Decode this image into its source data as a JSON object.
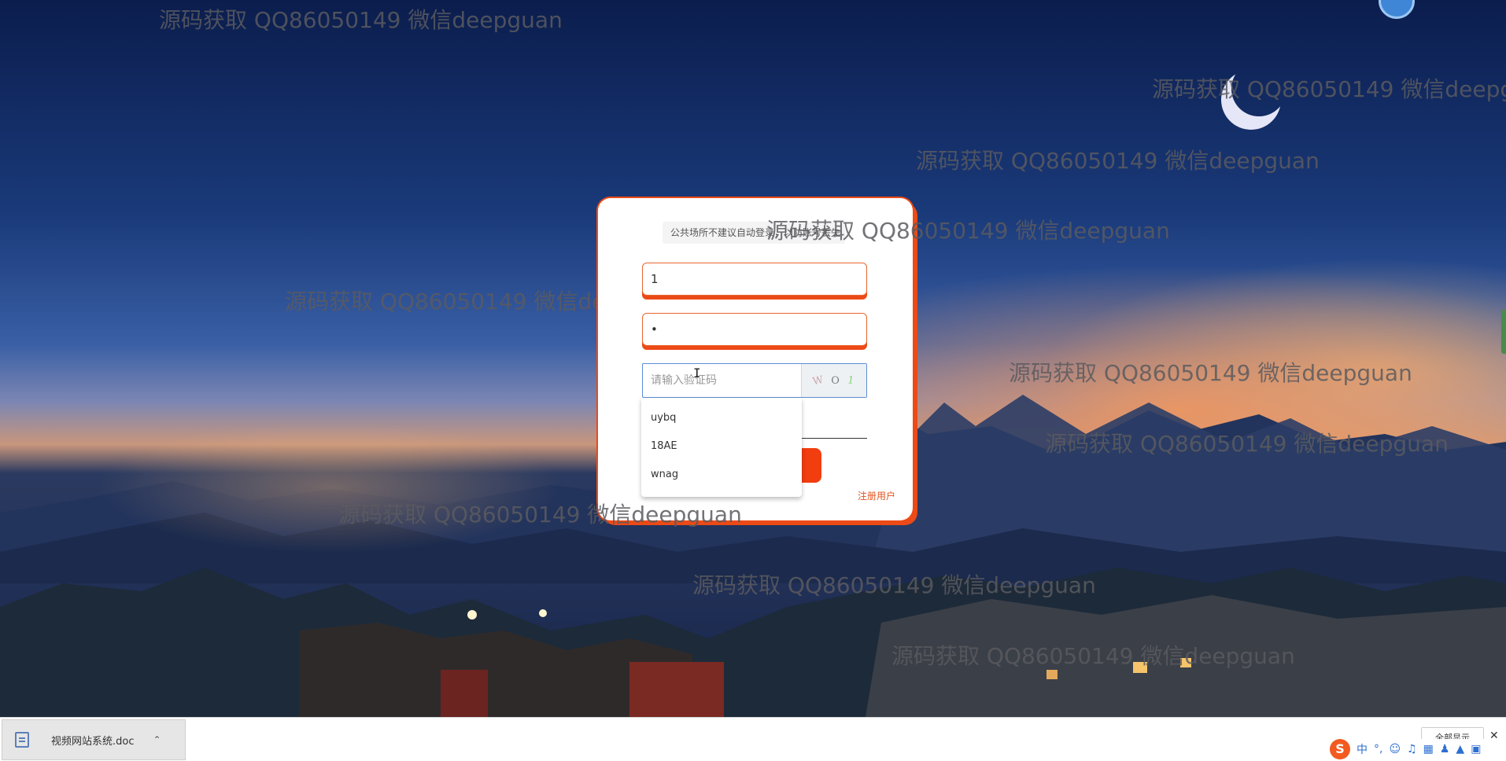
{
  "login": {
    "tip": "公共场所不建议自动登录，以防账号丢失",
    "username_value": "1",
    "password_value": "•",
    "captcha_placeholder": "请输入验证码",
    "captcha_chars": [
      "W",
      "O",
      "1"
    ],
    "register_link": "注册用户"
  },
  "autocomplete": {
    "options": [
      "uybq",
      "18AE",
      "wnag"
    ]
  },
  "watermark_text": "源码获取 QQ86050149 微信deepguan",
  "download_bar": {
    "file_name": "视频网站系统.doc",
    "show_all": "全部显示"
  },
  "ime": {
    "logo": "S",
    "mode": "中"
  },
  "colors": {
    "accent": "#ec4a16",
    "button": "#f23d0f",
    "link": "#e0531f",
    "captcha_border": "#5b8dd6"
  }
}
